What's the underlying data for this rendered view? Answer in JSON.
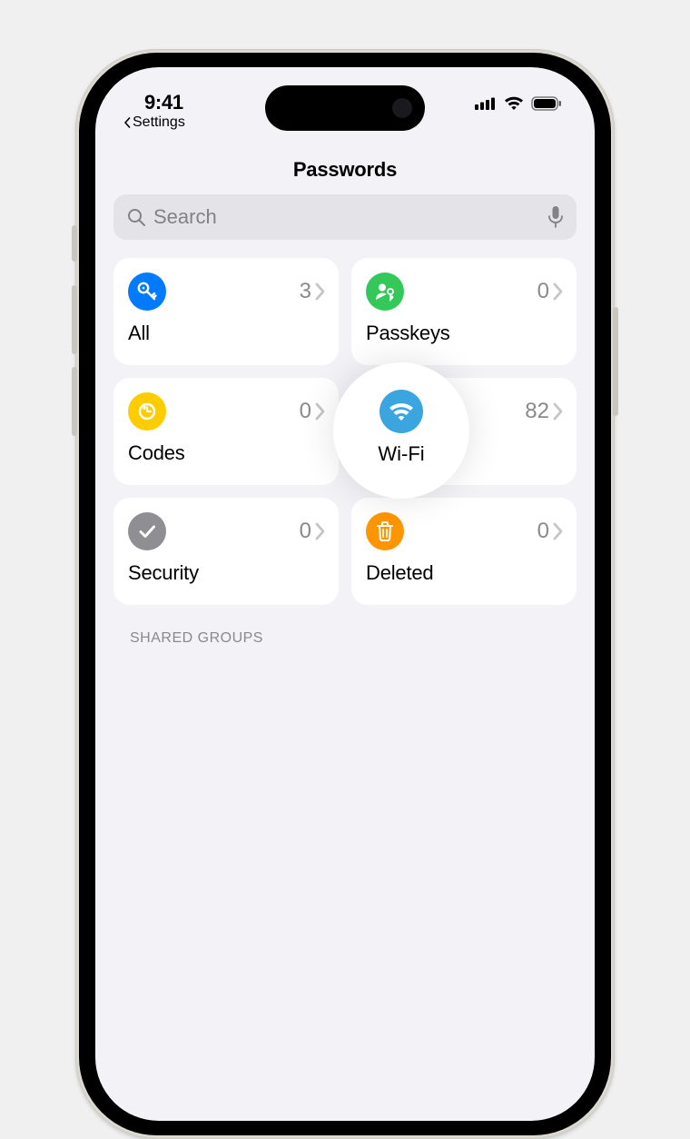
{
  "status": {
    "time": "9:41",
    "back_label": "Settings"
  },
  "title": "Passwords",
  "search": {
    "placeholder": "Search"
  },
  "cards": {
    "all": {
      "label": "All",
      "count": "3"
    },
    "passkeys": {
      "label": "Passkeys",
      "count": "0"
    },
    "codes": {
      "label": "Codes",
      "count": "0"
    },
    "wifi": {
      "label": "Wi-Fi",
      "count": "82"
    },
    "security": {
      "label": "Security",
      "count": "0"
    },
    "deleted": {
      "label": "Deleted",
      "count": "0"
    }
  },
  "section_header": "SHARED GROUPS",
  "colors": {
    "blue": "#007aff",
    "green": "#34c759",
    "yellow": "#ffcc00",
    "lblue": "#3aa5df",
    "gray": "#8e8e93",
    "orange": "#ff9500"
  }
}
